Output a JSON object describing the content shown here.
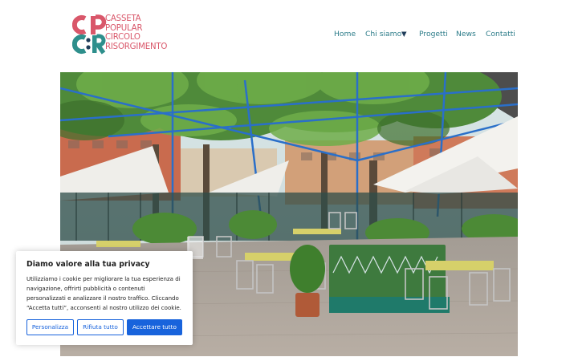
{
  "header": {
    "logo_lines": [
      "CASSETA",
      "POPULAR",
      "CIRCOLO",
      "RISORGIMENTO"
    ],
    "logo_colors": {
      "pink": "#d9576a",
      "teal": "#2e8f8c",
      "navy": "#1f3d5a"
    }
  },
  "nav": {
    "items": [
      {
        "label": "Home"
      },
      {
        "label": "Chi siamo",
        "has_submenu": true,
        "submenu_icon": "triangle-down-icon"
      },
      {
        "label": "Progetti"
      },
      {
        "label": "News"
      },
      {
        "label": "Contatti"
      }
    ],
    "color": "#2e7d8a"
  },
  "hero": {
    "description_icon": "photo-courtyard"
  },
  "cookie_banner": {
    "title": "Diamo valore alla tua privacy",
    "body_lines": [
      "Utilizziamo i cookie per migliorare la tua esperienza di",
      "navigazione, offrirti pubblicità o contenuti",
      "personalizzati e analizzare il nostro traffico. Cliccando",
      "“Accetta tutti”, acconsenti al nostro utilizzo dei cookie."
    ],
    "buttons": {
      "customize": "Personalizza",
      "reject": "Rifiuta tutto",
      "accept": "Accettare tutto"
    },
    "accent_color": "#1863dc"
  }
}
